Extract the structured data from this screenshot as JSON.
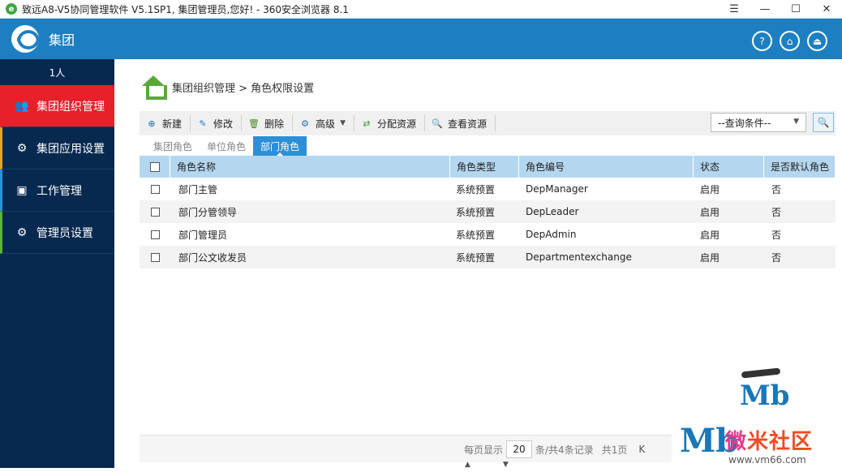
{
  "browser": {
    "title": "致远A8-V5协同管理软件 V5.1SP1, 集团管理员,您好! - 360安全浏览器 8.1",
    "controls": [
      "☰",
      "—",
      "☐",
      "✕"
    ]
  },
  "header": {
    "title": "集团",
    "icons": [
      "help-icon",
      "home-icon",
      "logout-icon"
    ],
    "icon_glyphs": [
      "?",
      "⌂",
      "⏏"
    ],
    "color": "#1d7fc2"
  },
  "sidebar": {
    "user_count": "1人",
    "items": [
      {
        "label": "集团组织管理",
        "icon": "org-users-icon",
        "glyph": "👥",
        "active": true
      },
      {
        "label": "集团应用设置",
        "icon": "gears-icon",
        "glyph": "⚙"
      },
      {
        "label": "工作管理",
        "icon": "monitor-icon",
        "glyph": "▣"
      },
      {
        "label": "管理员设置",
        "icon": "admin-gear-icon",
        "glyph": "⚙"
      }
    ],
    "active_color": "#e8202a"
  },
  "breadcrumb": {
    "text": "集团组织管理 > 角色权限设置"
  },
  "toolbar": {
    "buttons": [
      {
        "label": "新建",
        "icon": "new-icon",
        "glyph": "⊕"
      },
      {
        "label": "修改",
        "icon": "edit-icon",
        "glyph": "✎"
      },
      {
        "label": "删除",
        "icon": "delete-icon",
        "glyph": "🗑"
      },
      {
        "label": "高级",
        "icon": "advanced-gear-icon",
        "glyph": "⚙"
      },
      {
        "label": "分配资源",
        "icon": "assign-icon",
        "glyph": "⇄"
      },
      {
        "label": "查看资源",
        "icon": "view-search-icon",
        "glyph": "🔍"
      }
    ],
    "search_select": "--查询条件--",
    "search_button_glyph": "🔍"
  },
  "tabs": [
    {
      "label": "集团角色"
    },
    {
      "label": "单位角色"
    },
    {
      "label": "部门角色",
      "active": true
    }
  ],
  "table": {
    "columns": [
      "角色名称",
      "角色类型",
      "角色编号",
      "状态",
      "是否默认角色"
    ],
    "rows": [
      [
        "部门主管",
        "系统预置",
        "DepManager",
        "启用",
        "否"
      ],
      [
        "部门分管领导",
        "系统预置",
        "DepLeader",
        "启用",
        "否"
      ],
      [
        "部门管理员",
        "系统预置",
        "DepAdmin",
        "启用",
        "否"
      ],
      [
        "部门公文收发员",
        "系统预置",
        "Departmentexchange",
        "启用",
        "否"
      ]
    ]
  },
  "pager": {
    "per_page_label": "每页显示",
    "per_page": "20",
    "total_label": "条/共4条记录",
    "pages_label": "共1页",
    "first_glyph": "K"
  },
  "watermark": {
    "logo_text": "Mb",
    "name_a": "微",
    "name_b": "米社区",
    "url": "www.vm66.com"
  }
}
